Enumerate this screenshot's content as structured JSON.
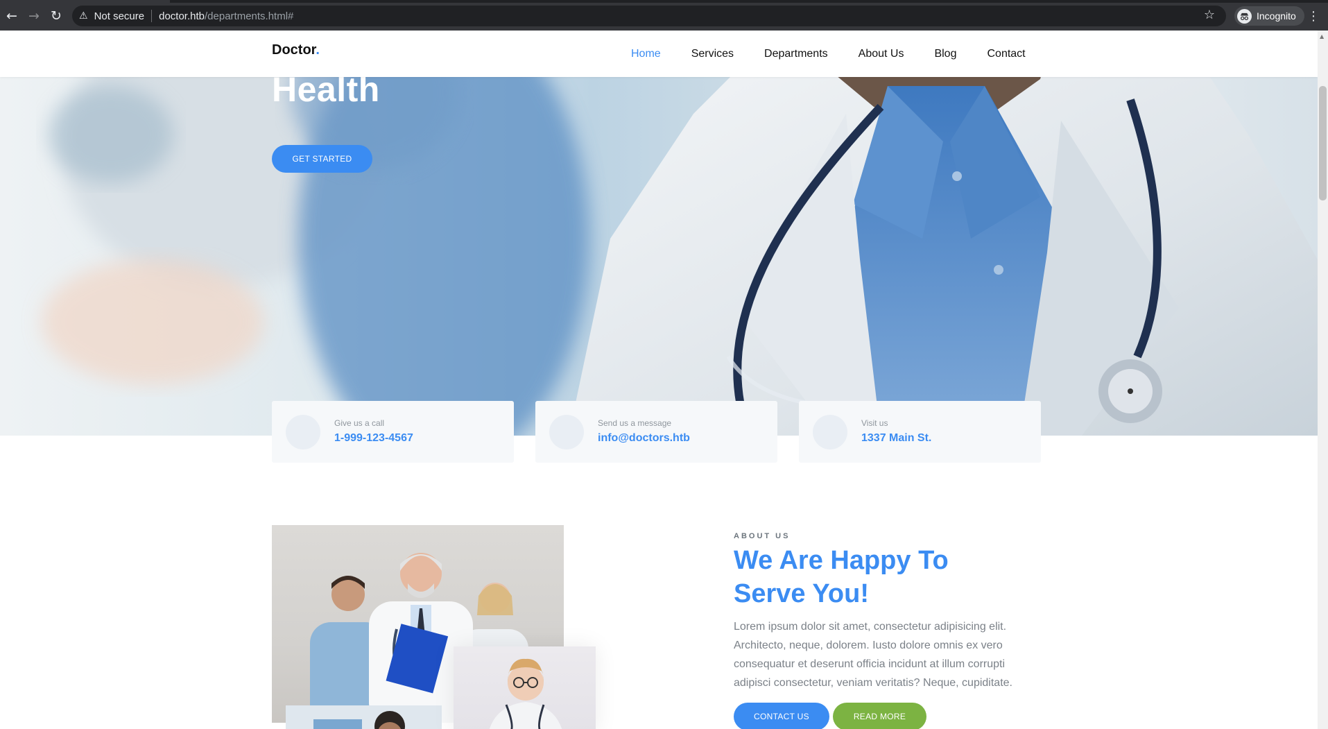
{
  "browser": {
    "security_label": "Not secure",
    "url_host": "doctor.htb",
    "url_path": "/departments.html#",
    "profile_label": "Incognito"
  },
  "header": {
    "logo_text": "Doctor",
    "logo_dot": ".",
    "nav": [
      {
        "label": "Home",
        "active": true
      },
      {
        "label": "Services"
      },
      {
        "label": "Departments"
      },
      {
        "label": "About Us"
      },
      {
        "label": "Blog"
      },
      {
        "label": "Contact"
      }
    ]
  },
  "hero": {
    "title_visible": "Health",
    "cta_label": "GET STARTED"
  },
  "contact_cards": [
    {
      "label": "Give us a call",
      "value": "1-999-123-4567"
    },
    {
      "label": "Send us a message",
      "value": "info@doctors.htb"
    },
    {
      "label": "Visit us",
      "value": "1337 Main St."
    }
  ],
  "about": {
    "eyebrow": "ABOUT US",
    "heading_line1": "We Are Happy To",
    "heading_line2": "Serve You!",
    "body": "Lorem ipsum dolor sit amet, consectetur adipisicing elit. Architecto, neque, dolorem. Iusto dolore omnis ex vero consequatur et deserunt officia incidunt at illum corrupti adipisci consectetur, veniam veritatis? Neque, cupiditate.",
    "contact_btn": "CONTACT US",
    "readmore_btn": "READ MORE"
  },
  "colors": {
    "accent": "#3b8cf2",
    "green": "#7cb342",
    "chrome_bg": "#35363a"
  }
}
